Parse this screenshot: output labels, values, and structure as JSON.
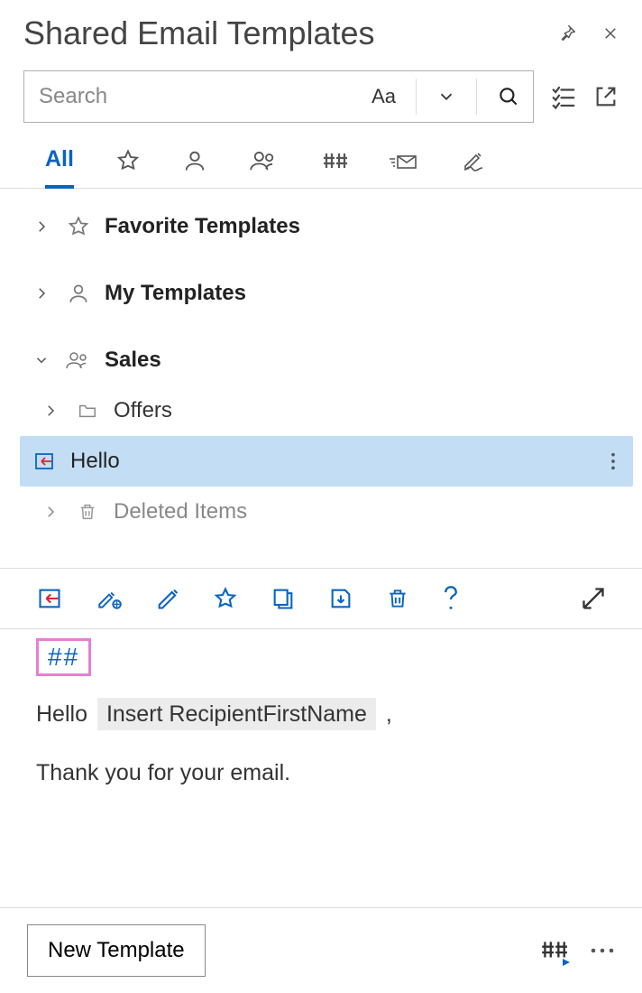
{
  "header": {
    "title": "Shared Email Templates"
  },
  "search": {
    "placeholder": "Search",
    "aa_label": "Aa"
  },
  "tabs": {
    "all": "All"
  },
  "tree": {
    "favorite": "Favorite Templates",
    "my": "My Templates",
    "sales": "Sales",
    "offers": "Offers",
    "hello": "Hello",
    "deleted": "Deleted Items"
  },
  "preview": {
    "hash": "##",
    "greeting": "Hello",
    "placeholder": "Insert RecipientFirstName",
    "comma": ",",
    "body": "Thank you for your email."
  },
  "bottom": {
    "new_template": "New Template",
    "hash_icon": "##"
  }
}
